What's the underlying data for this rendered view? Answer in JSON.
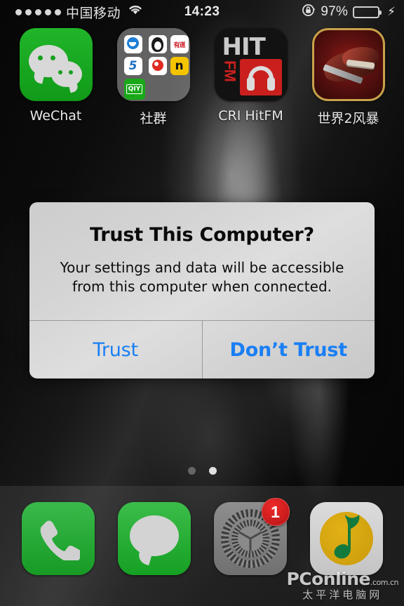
{
  "status_bar": {
    "signal_dots": 5,
    "carrier": "中国移动",
    "wifi_icon": "wifi-icon",
    "time": "14:23",
    "rotation_lock_icon": "rotation-lock-icon",
    "battery_percent": "97%",
    "battery_level": 97,
    "battery_color": "#49c54b",
    "charging_icon": "lightning-bolt-icon"
  },
  "home_screen": {
    "apps": [
      {
        "label": "WeChat",
        "icon": "wechat-icon"
      },
      {
        "label": "社群",
        "icon": "folder-icon",
        "folder_items": [
          "uc-browser-icon",
          "qq-icon",
          "youdao-icon",
          "qunar-icon",
          "weibo-bird-icon",
          "netease-icon",
          "iqiyi-icon"
        ],
        "folder_item_labels": [
          "",
          "",
          "有道",
          "5",
          "",
          "n",
          "QIY"
        ]
      },
      {
        "label": "CRI HitFM",
        "icon": "hitfm-icon",
        "icon_text_top": "HIT",
        "icon_text_side": "FM"
      },
      {
        "label": "世界2风暴",
        "icon": "dino-game-icon"
      }
    ],
    "page_indicator": {
      "total": 2,
      "active_index": 1
    }
  },
  "dock": {
    "apps": [
      {
        "name": "Phone",
        "icon": "phone-icon",
        "badge": ""
      },
      {
        "name": "Messages",
        "icon": "messages-icon",
        "badge": ""
      },
      {
        "name": "Settings",
        "icon": "settings-gear-icon",
        "badge": "1",
        "badge_color": "#d61f1f"
      },
      {
        "name": "QQ Music",
        "icon": "qq-music-note-icon",
        "badge": ""
      }
    ]
  },
  "alert": {
    "title": "Trust This Computer?",
    "message": "Your settings and data will be accessible from this computer when connected.",
    "buttons": [
      {
        "label": "Trust",
        "emphasis": "regular"
      },
      {
        "label": "Don’t Trust",
        "emphasis": "bold"
      }
    ],
    "accent_color": "#1a7ff5",
    "panel_color": "#d4d4d4"
  },
  "watermark": {
    "brand": "PConline",
    "brand_suffix": ".com.cn",
    "subtitle": "太平洋电脑网"
  }
}
